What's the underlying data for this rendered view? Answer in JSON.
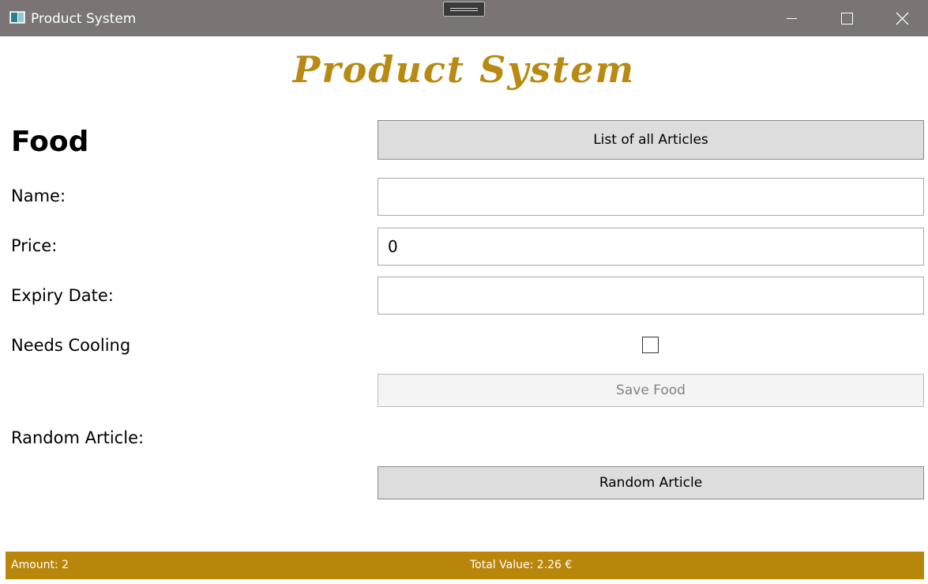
{
  "window": {
    "title": "Product System",
    "controls": {
      "minimize": "minimize-icon",
      "maximize": "maximize-icon",
      "close": "close-icon"
    }
  },
  "header": {
    "brand_title": "Product System"
  },
  "form": {
    "section_title": "Food",
    "list_button_label": "List of all Articles",
    "name_label": "Name:",
    "name_value": "",
    "price_label": "Price:",
    "price_value": "0",
    "expiry_label": "Expiry Date:",
    "expiry_value": "",
    "cooling_label": "Needs Cooling",
    "cooling_checked": false,
    "save_button_label": "Save Food",
    "random_label": "Random Article:",
    "random_value": "",
    "random_button_label": "Random Article"
  },
  "status": {
    "amount": "Amount: 2",
    "total": "Total Value: 2.26 €"
  },
  "colors": {
    "titlebar": "#7a7474",
    "brand": "#b88a13",
    "status_bar": "#b8860b"
  }
}
